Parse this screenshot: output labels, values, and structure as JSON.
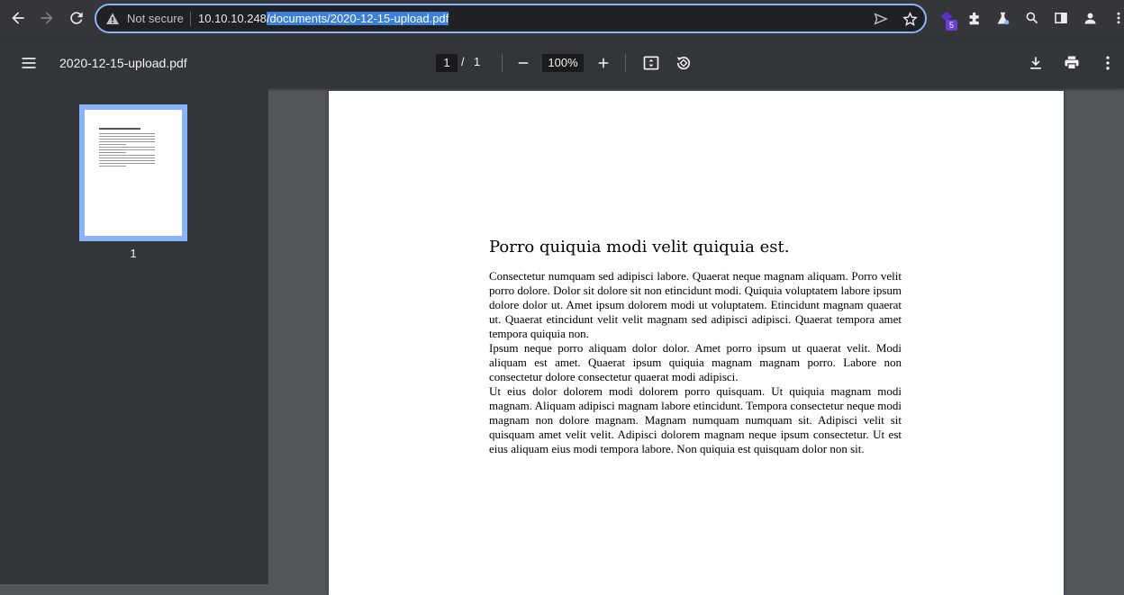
{
  "browser": {
    "security_label": "Not secure",
    "url_host": "10.10.10.248",
    "url_path": "/documents/2020-12-15-upload.pdf",
    "extension_badge": "5"
  },
  "toolbar": {
    "file_name": "2020-12-15-upload.pdf",
    "current_page": "1",
    "page_separator": "/",
    "total_pages": "1",
    "zoom": "100%"
  },
  "sidebar": {
    "thumbnail_label": "1"
  },
  "document": {
    "heading": "Porro quiquia modi velit quiquia est.",
    "paragraphs": [
      "Consectetur numquam sed adipisci labore. Quaerat neque magnam aliquam. Porro velit porro dolore. Dolor sit dolore sit non etincidunt modi. Quiquia voluptatem labore ipsum dolore dolor ut. Amet ipsum dolorem modi ut voluptatem. Etincidunt magnam quaerat ut. Quaerat etincidunt velit velit magnam sed adipisci adipisci. Quaerat tempora amet tempora quiquia non.",
      "Ipsum neque porro aliquam dolor dolor. Amet porro ipsum ut quaerat velit. Modi aliquam est amet. Quaerat ipsum quiquia magnam magnam porro. Labore non consectetur dolore consectetur quaerat modi adipisci.",
      "Ut eius dolor dolorem modi dolorem porro quisquam. Ut quiquia magnam modi magnam. Aliquam adipisci magnam labore etincidunt. Tempora consectetur neque modi magnam non dolore magnam. Magnam numquam numquam sit. Adipisci velit sit quisquam amet velit velit. Adipisci dolorem magnam neque ipsum consectetur. Ut est eius aliquam eius modi tempora labore. Non quiquia est quisquam dolor non sit."
    ]
  },
  "colors": {
    "accent": "#8ab4f8",
    "toolbar_bg": "#323639",
    "viewer_bg": "#525659"
  }
}
